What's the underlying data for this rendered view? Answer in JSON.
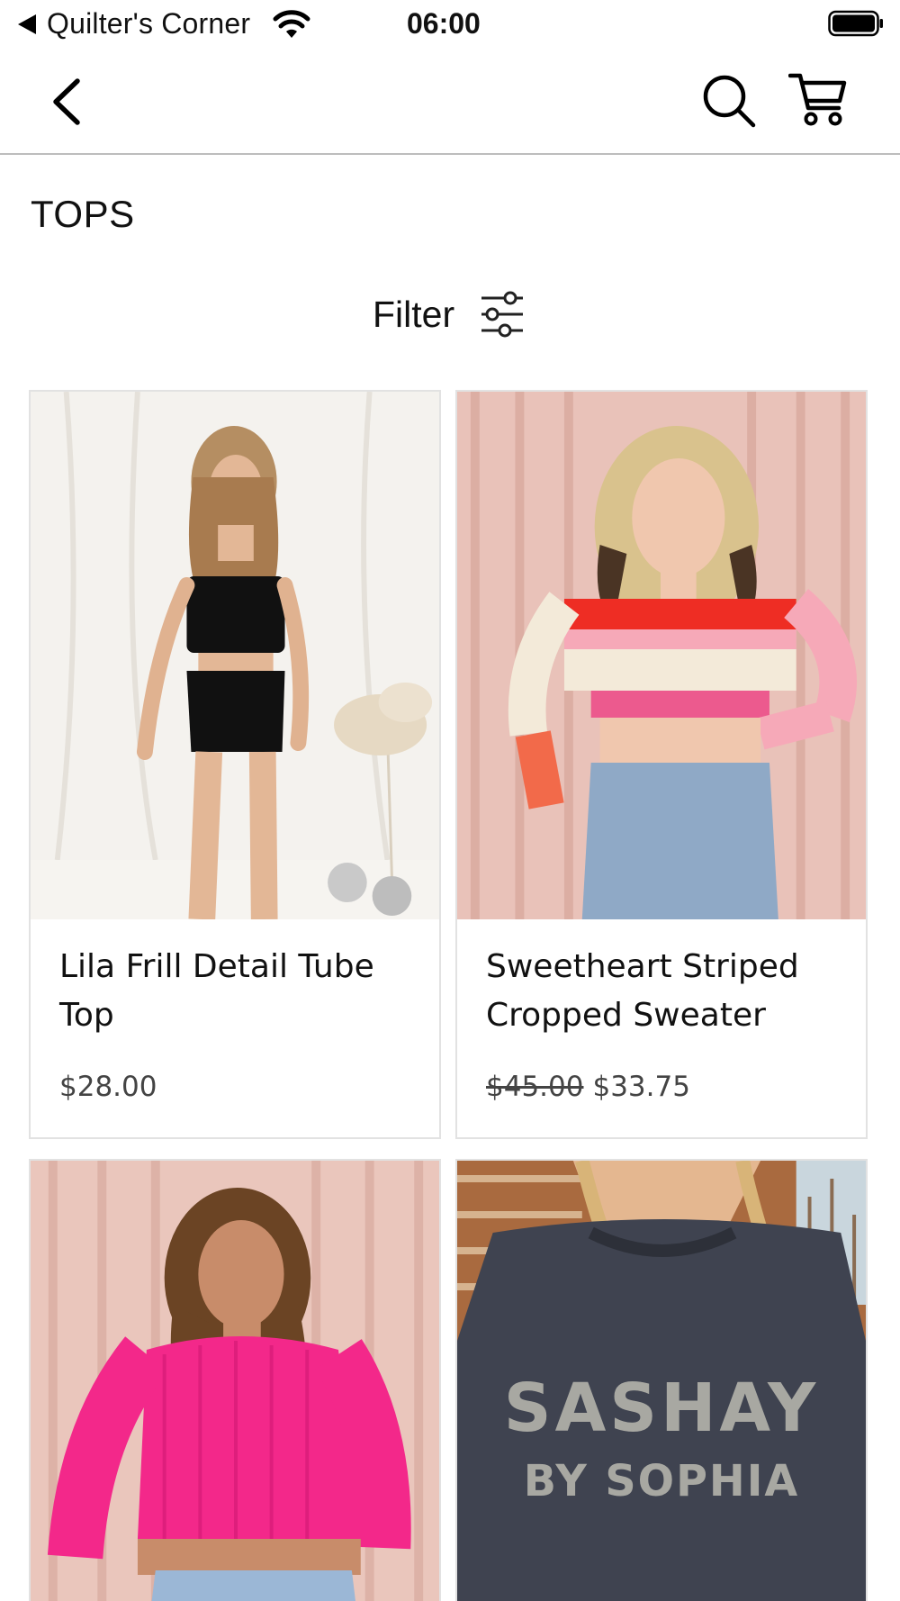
{
  "status_bar": {
    "carrier": "Quilter's Corner",
    "time": "06:00"
  },
  "nav": {
    "icons": [
      "chevron-left-icon",
      "search-icon",
      "cart-icon"
    ]
  },
  "page": {
    "title": "TOPS",
    "filter_label": "Filter"
  },
  "products": [
    {
      "name": "Lila Frill Detail Tube Top",
      "price": "$28.00",
      "original_price": "",
      "image": "woman in black tube top and skirt"
    },
    {
      "name": "Sweetheart Striped Cropped Sweater",
      "price": "$33.75",
      "original_price": "$45.00",
      "image": "woman in red, pink and cream striped cropped sweater"
    },
    {
      "name": "",
      "price": "",
      "original_price": "",
      "image": "woman in hot pink ribbed sweater"
    },
    {
      "name": "",
      "price": "",
      "original_price": "",
      "image": "charcoal sweatshirt",
      "print_line1": "SASHAY",
      "print_line2": "BY SOPHIA"
    }
  ],
  "colors": {
    "text": "#111111",
    "price": "#444444",
    "card_border": "#e2e2e2",
    "divider": "#bdbdbd"
  }
}
